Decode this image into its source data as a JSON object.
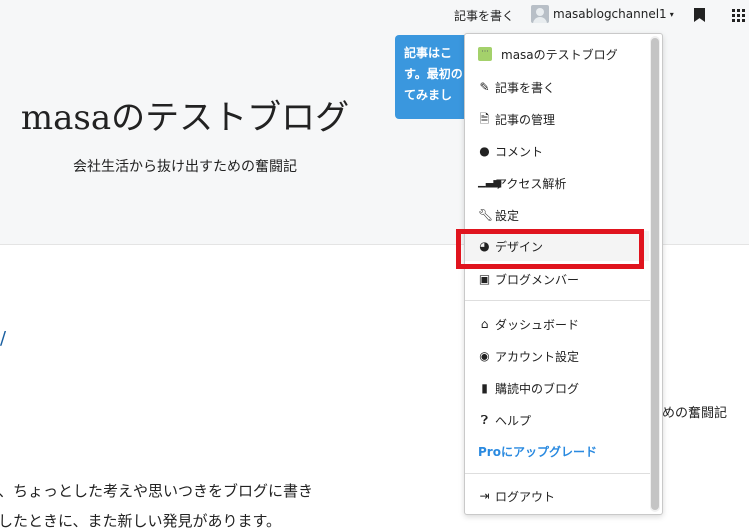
{
  "topbar": {
    "write_label": "記事を書く",
    "username": "masablogchannel1",
    "caret": "▾"
  },
  "blog": {
    "title": "masaのテストブログ",
    "description": "会社生活から抜け出すための奮闘記",
    "slash": "/",
    "body_line1": "、ちょっとした考えや思いつきをブログに書き",
    "body_line2": "したときに、また新しい発見があります。",
    "side_text": "めの奮闘記"
  },
  "tooltip": {
    "line1": "記事はこ",
    "line2": "す。最初の",
    "line3": "てみまし"
  },
  "dropdown": {
    "blog_name": "masaのテストブログ",
    "items": [
      {
        "label": "記事を書く",
        "icon": "pencil-icon"
      },
      {
        "label": "記事の管理",
        "icon": "document-icon"
      },
      {
        "label": "コメント",
        "icon": "comment-icon"
      },
      {
        "label": "アクセス解析",
        "icon": "bar-chart-icon"
      },
      {
        "label": "設定",
        "icon": "wrench-icon"
      },
      {
        "label": "デザイン",
        "icon": "palette-icon"
      },
      {
        "label": "ブログメンバー",
        "icon": "member-icon"
      }
    ],
    "account_items": [
      {
        "label": "ダッシュボード",
        "icon": "home-icon"
      },
      {
        "label": "アカウント設定",
        "icon": "user-circle-icon"
      },
      {
        "label": "購読中のブログ",
        "icon": "bookmark-icon"
      },
      {
        "label": "ヘルプ",
        "icon": "question-icon"
      }
    ],
    "pro_label": "Proにアップグレード",
    "logout_label": "ログアウト"
  },
  "colors": {
    "accent": "#2a8ae0",
    "tooltip": "#3a97de",
    "highlight_box": "#e0141e"
  }
}
